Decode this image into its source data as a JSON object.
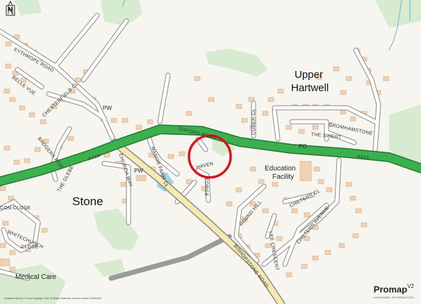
{
  "map": {
    "places": {
      "stone": "Stone",
      "upper": "Upper",
      "hartwell": "Hartwell"
    },
    "facilities": {
      "education_1": "Education",
      "education_2": "Facility",
      "medical_care": "Medical Care",
      "pw_north": "PW",
      "pw_south": "PW",
      "po": "PO"
    },
    "roads": {
      "eythrope_road": "EYTHROPE ROAD",
      "belle_vue": "BELLE VUE",
      "chesterfield_cl": "CHESTERFIELD CL",
      "badgers_rise": "BADGERS RISE",
      "the_glebe": "THE GLEBE",
      "a418_west": "A418",
      "a418_east": "A418",
      "church_way": "CHURCH WAY",
      "manor_farm_cl": "MANOR FARM CL",
      "oxford_road": "OXFORD ROAD",
      "haven": "HAVEN",
      "forge": "FORGE",
      "cuberc": "CUBER CL",
      "the_spiert": "THE SPIERT",
      "cromhamstone": "CROMHAMSTONE",
      "round_hill": "ROUND HILL",
      "chiltern_cl": "CHILTERN CL",
      "chiltern_avenue": "CHILTERN AVENUE",
      "lee_crescent": "LEE CRESCENT",
      "bishopstone_road": "BISHOPSTONE ROAD",
      "con_close": "CON CLOSE",
      "whitechurch_close_1": "WHITECHURCH",
      "whitechurch_close_2": "CLOSE"
    },
    "north_arrow_letter": "N",
    "copyright": "Ordnance Survey © Crown Copyright 2020. All Rights Reserved. Licence number 100022432",
    "brand": {
      "name": "Promap",
      "version": "V2",
      "tagline": "LANDMARK INFORMATION"
    },
    "colors": {
      "background": "#f7f5f0",
      "a_road": "#3cb04e",
      "b_road": "#f4e9b0",
      "minor_road": "#ffffff",
      "road_casing": "#8a8a8a",
      "building": "#f0d1b2",
      "building_edge": "#c9a080",
      "green_space": "#d6ebcf",
      "water": "#9bd3e8",
      "site_circle": "#d9151b"
    }
  }
}
